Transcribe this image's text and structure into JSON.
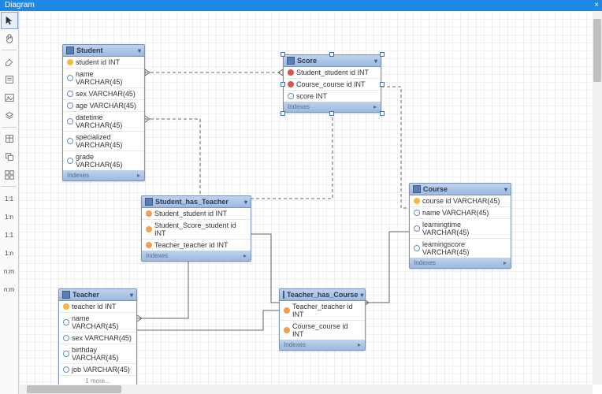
{
  "window": {
    "title": "Diagram"
  },
  "toolbar": {
    "tools": [
      "pointer",
      "hand",
      "eraser",
      "note",
      "image",
      "layer",
      "region",
      "copy",
      "grid"
    ],
    "relations": [
      "1:1",
      "1:n",
      "1:1",
      "1:n",
      "n:m",
      "n:m"
    ]
  },
  "indexes_label": "Indexes",
  "entities": {
    "student": {
      "title": "Student",
      "columns": [
        {
          "icon": "pk",
          "label": "student id INT"
        },
        {
          "icon": "attr",
          "label": "name VARCHAR(45)"
        },
        {
          "icon": "attr",
          "label": "sex VARCHAR(45)"
        },
        {
          "icon": "attr",
          "label": "age VARCHAR(45)"
        },
        {
          "icon": "attr",
          "label": "datetime VARCHAR(45)"
        },
        {
          "icon": "attr",
          "label": "specialized VARCHAR(45)"
        },
        {
          "icon": "attr",
          "label": "grade VARCHAR(45)"
        }
      ]
    },
    "score": {
      "title": "Score",
      "selected": true,
      "columns": [
        {
          "icon": "fk",
          "label": "Student_student id INT"
        },
        {
          "icon": "fk",
          "label": "Course_course id INT"
        },
        {
          "icon": "attr",
          "label": "score INT"
        }
      ]
    },
    "student_has_teacher": {
      "title": "Student_has_Teacher",
      "columns": [
        {
          "icon": "idx",
          "label": "Student_student id INT"
        },
        {
          "icon": "idx",
          "label": "Student_Score_student id INT"
        },
        {
          "icon": "idx",
          "label": "Teacher_teacher id INT"
        }
      ]
    },
    "course": {
      "title": "Course",
      "columns": [
        {
          "icon": "pk",
          "label": "course id VARCHAR(45)"
        },
        {
          "icon": "attr",
          "label": "name VARCHAR(45)"
        },
        {
          "icon": "attr",
          "label": "learningtime VARCHAR(45)"
        },
        {
          "icon": "attr",
          "label": "learningscore VARCHAR(45)"
        }
      ]
    },
    "teacher": {
      "title": "Teacher",
      "columns": [
        {
          "icon": "pk",
          "label": "teacher id INT"
        },
        {
          "icon": "attr",
          "label": "name VARCHAR(45)"
        },
        {
          "icon": "attr",
          "label": "sex VARCHAR(45)"
        },
        {
          "icon": "attr",
          "label": "birthday VARCHAR(45)"
        },
        {
          "icon": "attr",
          "label": "job VARCHAR(45)"
        }
      ],
      "more": "1 more..."
    },
    "teacher_has_course": {
      "title": "Teacher_has_Course",
      "columns": [
        {
          "icon": "idx",
          "label": "Teacher_teacher id INT"
        },
        {
          "icon": "idx",
          "label": "Course_course id INT"
        }
      ]
    }
  }
}
